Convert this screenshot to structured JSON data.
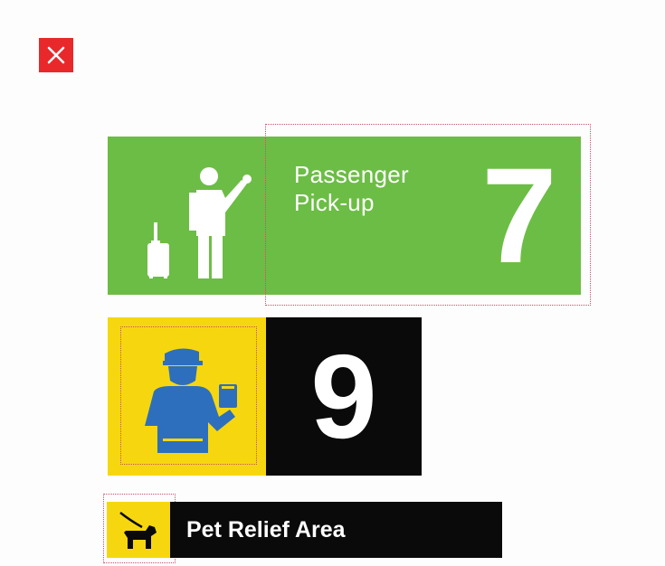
{
  "close_control": {
    "icon": "close-icon",
    "color": "#e8282b"
  },
  "signs": {
    "pickup": {
      "icon": "traveler-hailing-with-luggage-icon",
      "line1": "Passenger",
      "line2": "Pick-up",
      "number": "7",
      "background": "#6cbd45"
    },
    "immigration": {
      "icon": "officer-checking-passport-icon",
      "number": "9",
      "icon_background": "#f6d70f",
      "number_background": "#0a0a0a",
      "icon_color": "#2e6fbd"
    },
    "pet_relief": {
      "icon": "dog-on-leash-icon",
      "label": "Pet Relief Area",
      "icon_background": "#f6d70f",
      "label_background": "#0a0a0a"
    }
  }
}
